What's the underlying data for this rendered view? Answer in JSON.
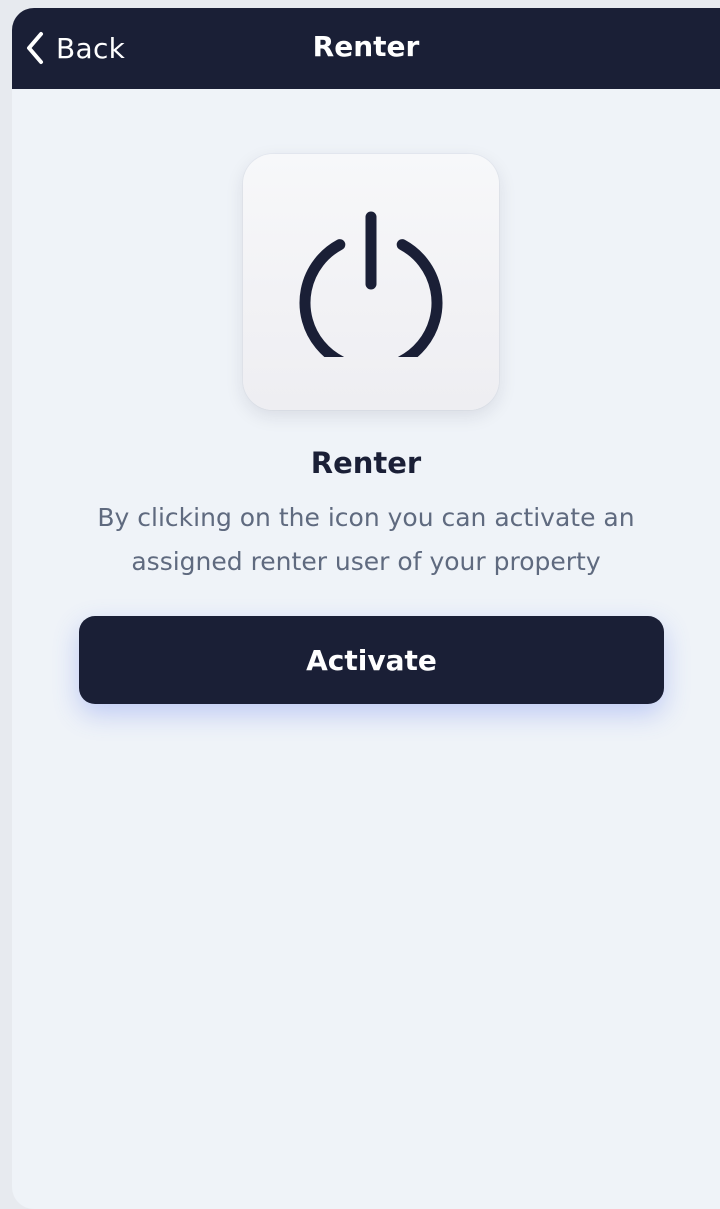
{
  "navbar": {
    "back_label": "Back",
    "title": "Renter",
    "back_icon": "chevron-left-icon",
    "background": "#1a1f36"
  },
  "main": {
    "icon": "power-icon",
    "title": "Renter",
    "description": "By clicking on the icon you can activate an assigned renter user of your property",
    "activate_label": "Activate"
  },
  "colors": {
    "primary": "#1a1f36",
    "background": "#eff3f8",
    "text_secondary": "#5f6a7f",
    "button_glow": "#506ef0"
  }
}
